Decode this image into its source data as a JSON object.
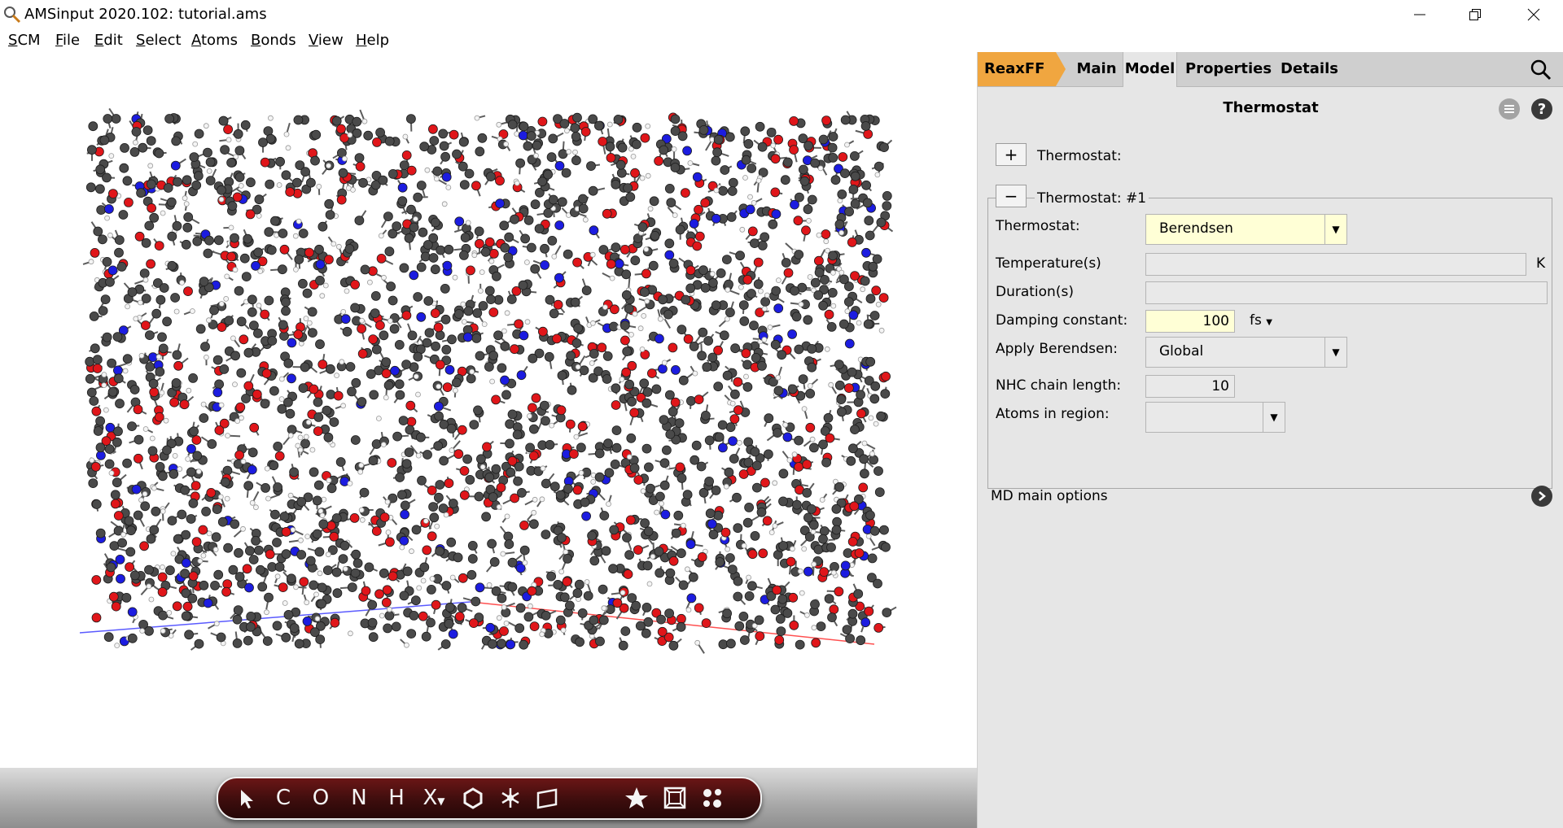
{
  "window": {
    "title": "AMSinput 2020.102: tutorial.ams"
  },
  "menu": [
    {
      "first": "S",
      "rest": "CM"
    },
    {
      "first": "F",
      "rest": "ile"
    },
    {
      "first": "E",
      "rest": "dit"
    },
    {
      "first": "S",
      "rest": "elect"
    },
    {
      "first": "A",
      "rest": "toms"
    },
    {
      "first": "B",
      "rest": "onds"
    },
    {
      "first": "V",
      "rest": "iew"
    },
    {
      "first": "H",
      "rest": "elp"
    }
  ],
  "tabs": [
    "ReaxFF",
    "Main",
    "Model",
    "Properties",
    "Details"
  ],
  "active_tab": "Model",
  "panel": {
    "section_title": "Thermostat",
    "add_label": "Thermostat:",
    "group_label": "Thermostat: #1",
    "thermostat_label": "Thermostat:",
    "thermostat_value": "Berendsen",
    "temperature_label": "Temperature(s)",
    "temperature_unit": "K",
    "duration_label": "Duration(s)",
    "damping_label": "Damping constant:",
    "damping_value": "100",
    "damping_unit": "fs",
    "apply_label": "Apply Berendsen:",
    "apply_value": "Global",
    "nhc_label": "NHC chain length:",
    "nhc_value": "10",
    "atoms_label": "Atoms in region:",
    "atoms_value": "",
    "md_label": "MD main options"
  },
  "toolbar": {
    "tools": [
      "C",
      "O",
      "N",
      "H",
      "X"
    ]
  },
  "colors": {
    "accent_tab": "#f0a640",
    "input_highlight": "#ffffd6",
    "carbon": "#4a4a4a",
    "oxygen": "#e0161a",
    "nitrogen": "#1c1ce0",
    "hydrogen": "#f4f4f4"
  }
}
